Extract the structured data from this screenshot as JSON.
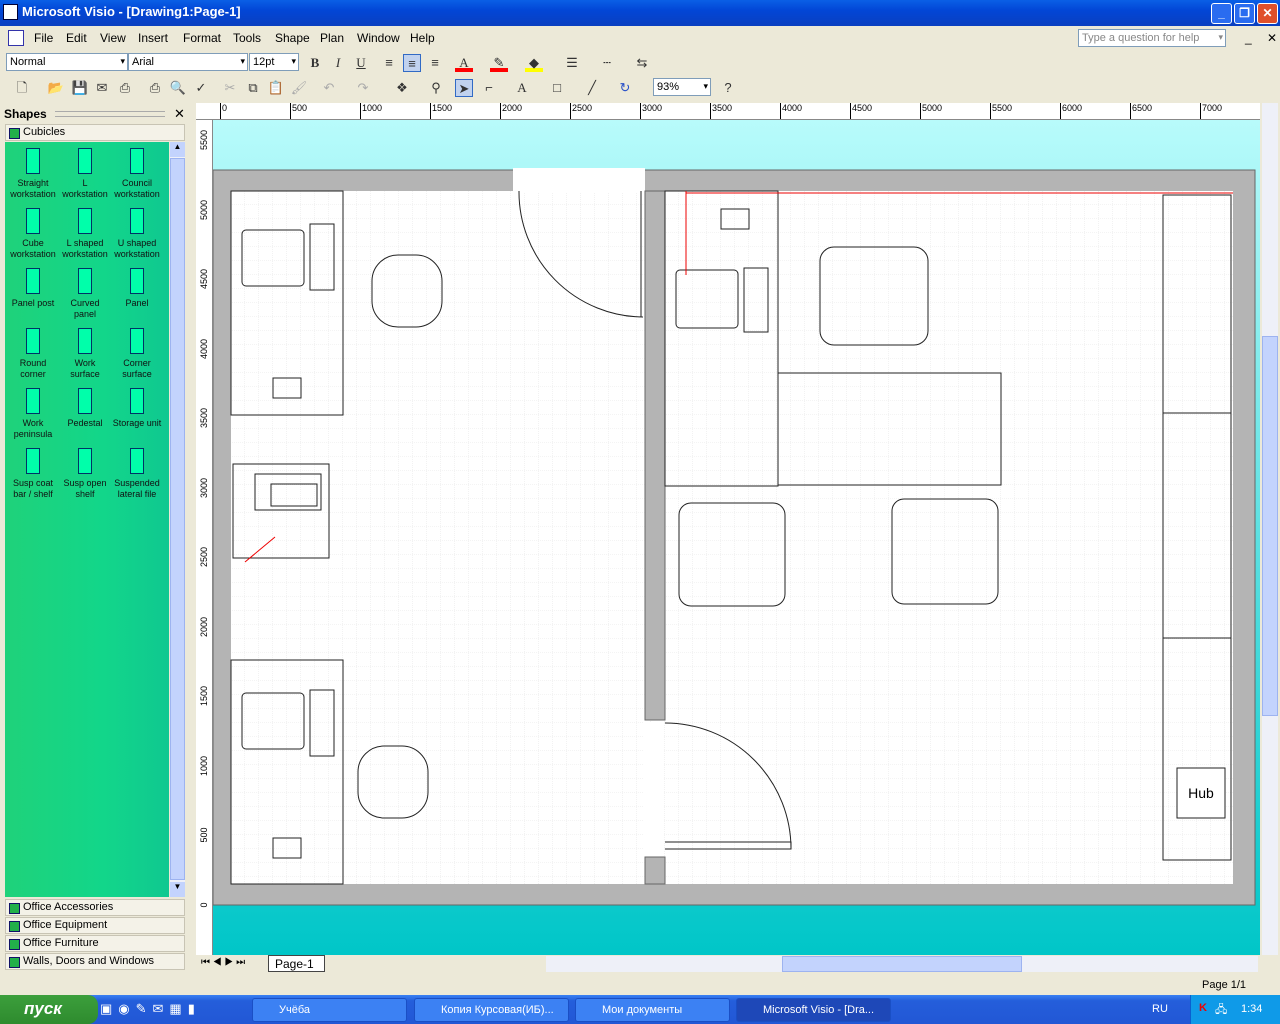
{
  "window": {
    "title": "Microsoft Visio - [Drawing1:Page-1]",
    "help_placeholder": "Type a question for help"
  },
  "menu": [
    "File",
    "Edit",
    "View",
    "Insert",
    "Format",
    "Tools",
    "Shape",
    "Plan",
    "Window",
    "Help"
  ],
  "format_toolbar": {
    "style": "Normal",
    "font": "Arial",
    "size": "12pt",
    "colors": {
      "font": "#ff0000",
      "line": "#ff0000",
      "fill": "#ffff00"
    }
  },
  "standard_toolbar": {
    "zoom": "93%"
  },
  "shapes_panel": {
    "title": "Shapes",
    "open_stencil": "Cubicles",
    "items": [
      "Straight workstation",
      "L workstation",
      "Council workstation",
      "Cube workstation",
      "L shaped workstation",
      "U shaped workstation",
      "Panel post",
      "Curved panel",
      "Panel",
      "Round corner",
      "Work surface",
      "Corner surface",
      "Work peninsula",
      "Pedestal",
      "Storage unit",
      "Susp coat bar / shelf",
      "Susp open shelf",
      "Suspended lateral file"
    ],
    "categories": [
      "Office Accessories",
      "Office Equipment",
      "Office Furniture",
      "Walls, Doors and Windows"
    ]
  },
  "ruler": {
    "top": [
      "0",
      "500",
      "1000",
      "1500",
      "2000",
      "2500",
      "3000",
      "3500",
      "4000",
      "4500",
      "5000",
      "5500",
      "6000",
      "6500",
      "7000"
    ],
    "left": [
      "5500",
      "5000",
      "4500",
      "4000",
      "3500",
      "3000",
      "2500",
      "2000",
      "1500",
      "1000",
      "500",
      "0"
    ]
  },
  "drawing": {
    "hub_label": "Hub"
  },
  "page_tab": "Page-1",
  "status": {
    "page": "Page 1/1"
  },
  "taskbar": {
    "start": "пуск",
    "tasks": [
      "Учёба",
      "Копия Курсовая(ИБ)...",
      "Мои документы",
      "Microsoft Visio - [Dra..."
    ],
    "lang": "RU",
    "clock": "1:34"
  }
}
